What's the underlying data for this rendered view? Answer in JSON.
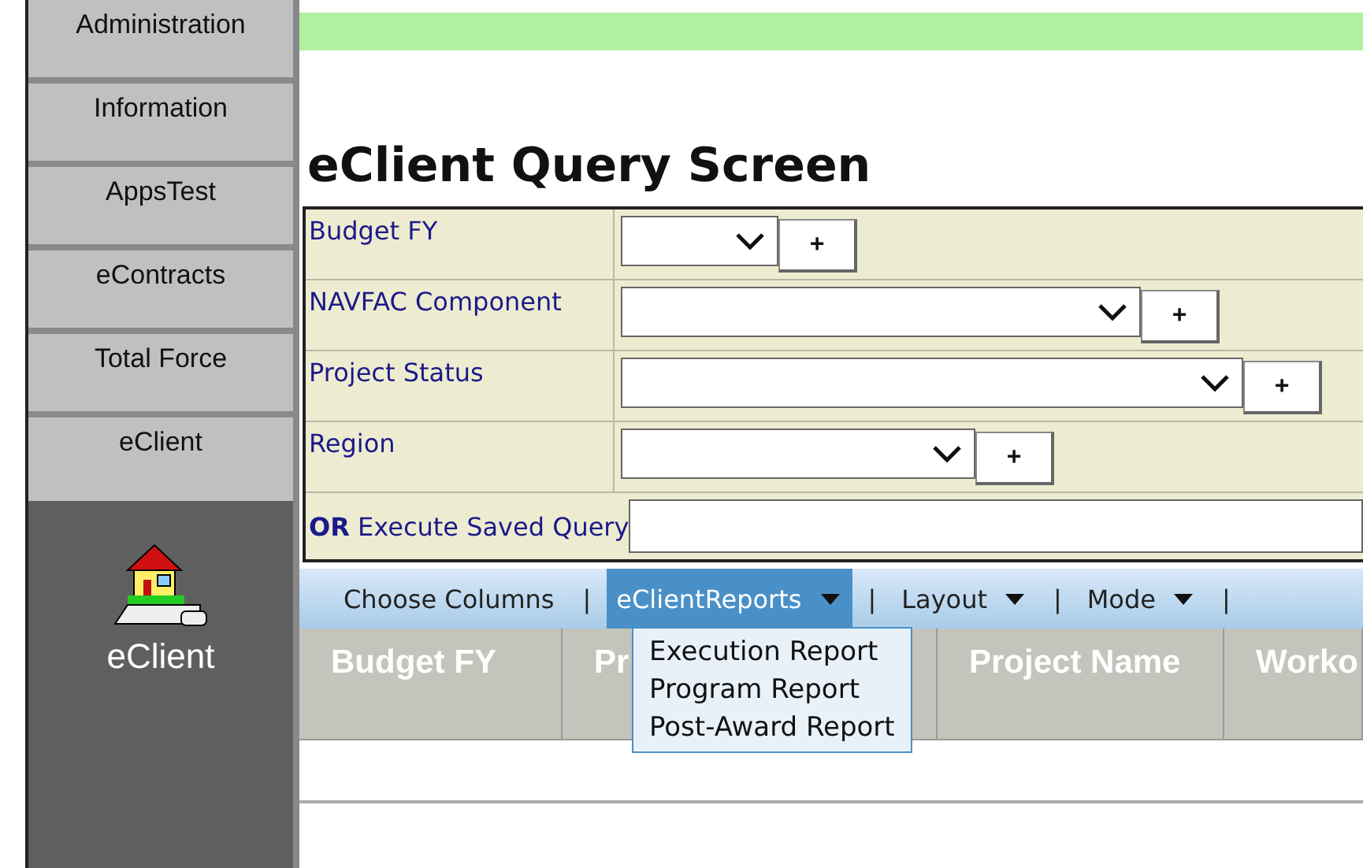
{
  "sidebar": {
    "items": [
      {
        "label": "Administration",
        "selected": false
      },
      {
        "label": "Information",
        "selected": false
      },
      {
        "label": "AppsTest",
        "selected": false
      },
      {
        "label": "eContracts",
        "selected": false
      },
      {
        "label": "Total Force",
        "selected": false
      },
      {
        "label": "eClient",
        "selected": true
      }
    ],
    "active_app": {
      "label": "eClient"
    }
  },
  "page": {
    "title": "eClient Query Screen"
  },
  "query_form": {
    "fields": [
      {
        "label": "Budget FY",
        "button": "+"
      },
      {
        "label": "NAVFAC Component",
        "button": "+"
      },
      {
        "label": "Project Status",
        "button": "+"
      },
      {
        "label": "Region",
        "button": "+"
      }
    ],
    "saved_query": {
      "label": "**OR** Execute Saved Query"
    }
  },
  "toolbar": {
    "items": [
      {
        "label": "Choose Columns",
        "dropdown": false,
        "selected": false
      },
      {
        "label": "eClientReports",
        "dropdown": true,
        "selected": true
      },
      {
        "label": "Layout",
        "dropdown": true,
        "selected": false
      },
      {
        "label": "Mode",
        "dropdown": true,
        "selected": false
      }
    ],
    "separator": "|"
  },
  "reports_menu": {
    "items": [
      "Execution Report",
      "Program Report",
      "Post-Award Report"
    ]
  },
  "table": {
    "columns": [
      "Budget FY",
      "Pr",
      "Project Name",
      "Worko"
    ]
  }
}
